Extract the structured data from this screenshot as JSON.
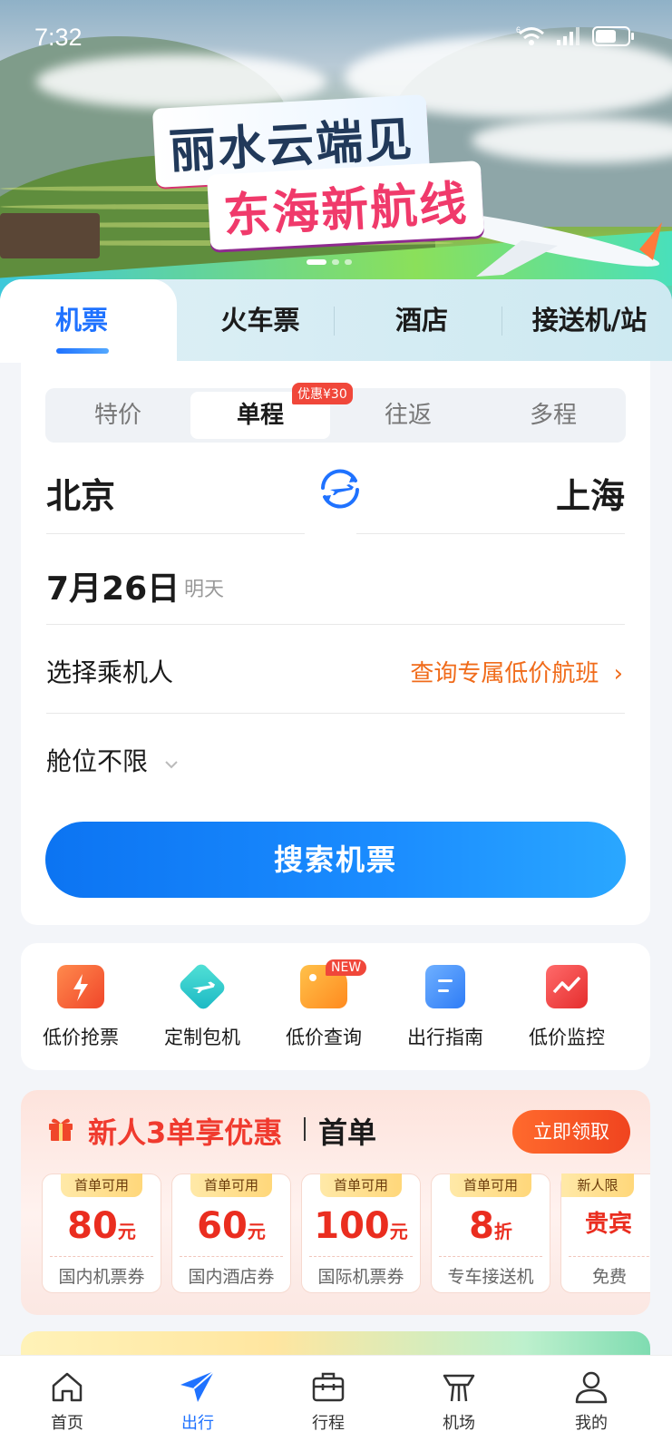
{
  "status_bar": {
    "time": "7:32",
    "network": "6"
  },
  "banner": {
    "title_line1": "丽水云端见",
    "title_line2": "东海新航线"
  },
  "main_tabs": [
    {
      "label": "机票",
      "active": true
    },
    {
      "label": "火车票",
      "active": false
    },
    {
      "label": "酒店",
      "active": false
    },
    {
      "label": "接送机/站",
      "active": false
    }
  ],
  "trip_types": [
    {
      "label": "特价",
      "active": false
    },
    {
      "label": "单程",
      "active": true,
      "badge": "优惠¥30"
    },
    {
      "label": "往返",
      "active": false
    },
    {
      "label": "多程",
      "active": false
    }
  ],
  "flight": {
    "from_city": "北京",
    "to_city": "上海",
    "date": "7月26日",
    "date_hint": "明天",
    "passenger_label": "选择乘机人",
    "exclusive_link": "查询专属低价航班",
    "cabin_label": "舱位不限",
    "search_button": "搜索机票"
  },
  "tools": [
    {
      "label": "低价抢票",
      "icon": "ticket-flash-icon",
      "color": "#ff6a3d"
    },
    {
      "label": "定制包机",
      "icon": "plane-ticket-icon",
      "color": "#2fd0c8"
    },
    {
      "label": "低价查询",
      "icon": "price-tag-icon",
      "color": "#ffa024",
      "badge": "NEW"
    },
    {
      "label": "出行指南",
      "icon": "guide-book-icon",
      "color": "#3b8cff"
    },
    {
      "label": "低价监控",
      "icon": "price-monitor-icon",
      "color": "#f04848"
    }
  ],
  "promo": {
    "title": "新人3单享优惠",
    "subtitle": "首单",
    "button": "立即领取",
    "coupons": [
      {
        "tag": "首单可用",
        "value": "80",
        "unit": "元",
        "name": "国内机票券"
      },
      {
        "tag": "首单可用",
        "value": "60",
        "unit": "元",
        "name": "国内酒店券"
      },
      {
        "tag": "首单可用",
        "value": "100",
        "unit": "元",
        "name": "国际机票券"
      },
      {
        "tag": "首单可用",
        "value": "8",
        "unit": "折",
        "name": "专车接送机"
      },
      {
        "tag": "新人限",
        "value": "贵宾",
        "unit": "",
        "name": "免费"
      }
    ]
  },
  "bottom_nav": [
    {
      "label": "首页",
      "active": false
    },
    {
      "label": "出行",
      "active": true
    },
    {
      "label": "行程",
      "active": false
    },
    {
      "label": "机场",
      "active": false
    },
    {
      "label": "我的",
      "active": false
    }
  ]
}
